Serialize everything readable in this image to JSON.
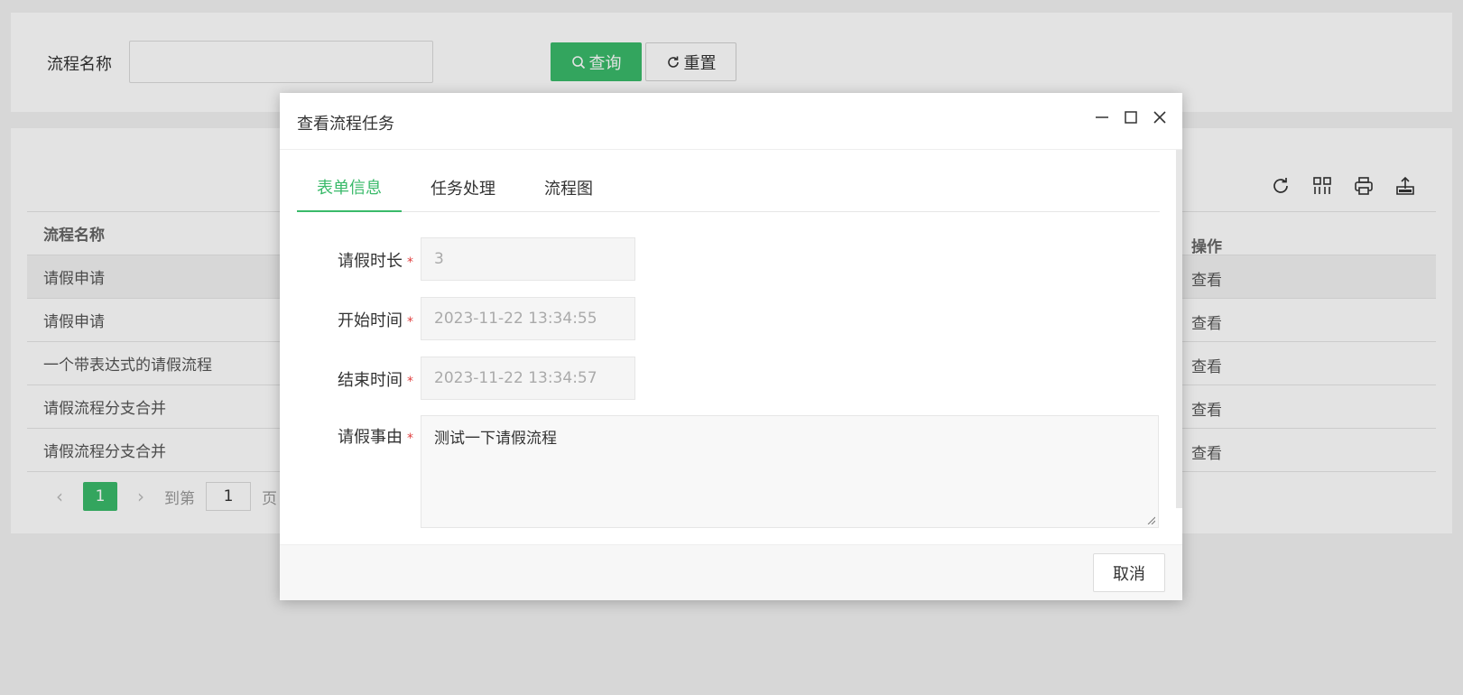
{
  "search": {
    "label": "流程名称",
    "input_value": "",
    "query_label": "查询",
    "reset_label": "重置"
  },
  "table": {
    "columns": [
      "流程名称",
      "操作"
    ],
    "rows": [
      {
        "name": "请假申请",
        "action": "查看"
      },
      {
        "name": "请假申请",
        "action": "查看"
      },
      {
        "name": "一个带表达式的请假流程",
        "action": "查看"
      },
      {
        "name": "请假流程分支合并",
        "action": "查看"
      },
      {
        "name": "请假流程分支合并",
        "action": "查看"
      }
    ],
    "toolbar_icons": [
      "refresh-icon",
      "columns-icon",
      "print-icon",
      "export-icon"
    ]
  },
  "pager": {
    "current": "1",
    "goto_label": "到第",
    "goto_value": "1",
    "page_label": "页"
  },
  "modal": {
    "title": "查看流程任务",
    "tabs": [
      "表单信息",
      "任务处理",
      "流程图"
    ],
    "active_tab": "表单信息",
    "form": {
      "duration_label": "请假时长",
      "duration_value": "3",
      "start_label": "开始时间",
      "start_value": "2023-11-22 13:34:55",
      "end_label": "结束时间",
      "end_value": "2023-11-22 13:34:57",
      "reason_label": "请假事由",
      "reason_value": "测试一下请假流程",
      "required_mark": "*"
    },
    "cancel_label": "取消"
  },
  "colors": {
    "accent": "#3aba6a",
    "required": "#e04040"
  }
}
